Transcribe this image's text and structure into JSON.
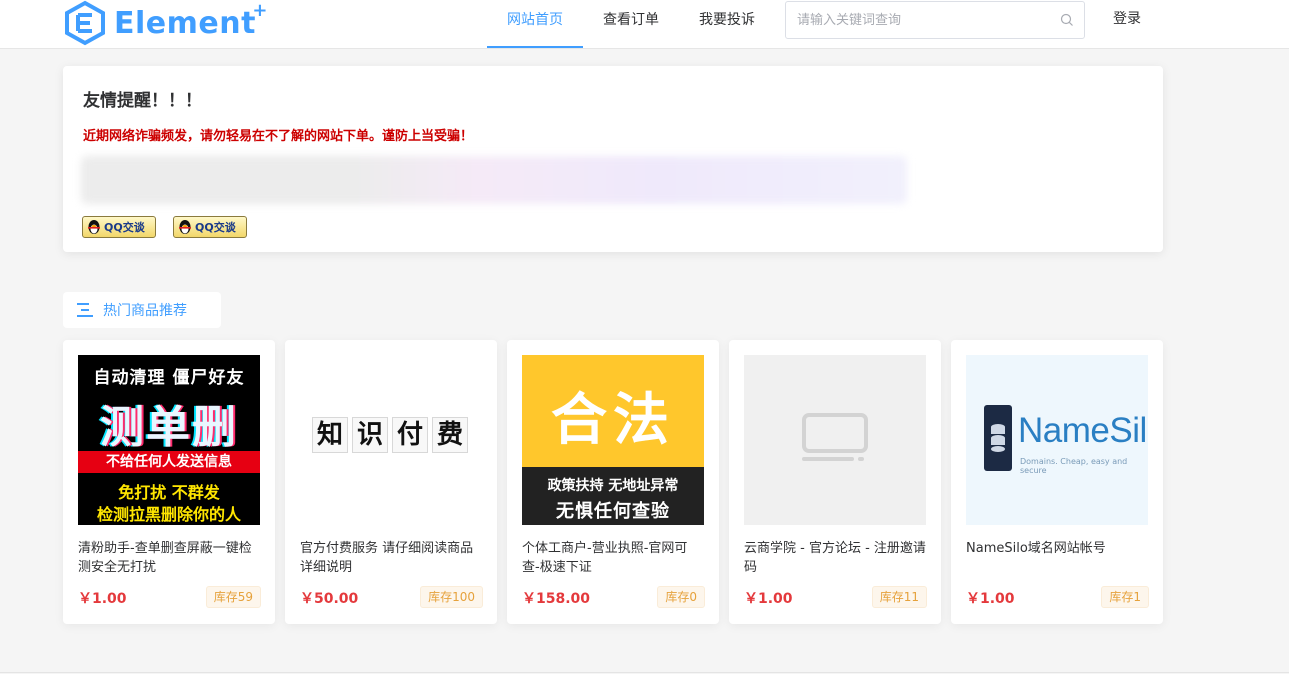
{
  "header": {
    "logo_text": "Element",
    "logo_plus": "+",
    "nav": [
      {
        "label": "网站首页",
        "active": true
      },
      {
        "label": "查看订单",
        "active": false
      },
      {
        "label": "我要投诉",
        "active": false
      }
    ],
    "search_placeholder": "请输入关键词查询",
    "login_label": "登录"
  },
  "notice": {
    "title": "友情提醒！！！",
    "warning": "近期网络诈骗频发，请勿轻易在不了解的网站下单。谨防上当受骗！",
    "qq_buttons": [
      "QQ交谈",
      "QQ交谈"
    ]
  },
  "section": {
    "title": "热门商品推荐"
  },
  "products": [
    {
      "name": "清粉助手-查单删查屏蔽一键检测安全无打扰",
      "price": "￥1.00",
      "stock": "库存59",
      "thumb": {
        "line1": "自动清理  僵尸好友",
        "line2": "测单删",
        "line3": "不给任何人发送信息",
        "line4": "免打扰  不群发",
        "line5": "检测拉黑删除你的人"
      }
    },
    {
      "name": "官方付费服务 请仔细阅读商品详细说明",
      "price": "￥50.00",
      "stock": "库存100",
      "thumb": {
        "chars": [
          "知",
          "识",
          "付",
          "费"
        ]
      }
    },
    {
      "name": "个体工商户-营业执照-官网可查-极速下证",
      "price": "￥158.00",
      "stock": "库存0",
      "thumb": {
        "big": "合法",
        "sub1": "政策扶持  无地址异常",
        "sub2": "无惧任何查验"
      }
    },
    {
      "name": "云商学院 - 官方论坛 - 注册邀请码",
      "price": "￥1.00",
      "stock": "库存11",
      "thumb": {}
    },
    {
      "name": "NameSilo域名网站帐号",
      "price": "￥1.00",
      "stock": "库存1",
      "thumb": {
        "brand": "NameSilo",
        "tagline": "Domains. Cheap, easy and secure"
      }
    }
  ],
  "colors": {
    "primary": "#409eff",
    "warning_red": "#cc0000",
    "price_red": "#e4393c",
    "stock_orange": "#e6a23c"
  }
}
